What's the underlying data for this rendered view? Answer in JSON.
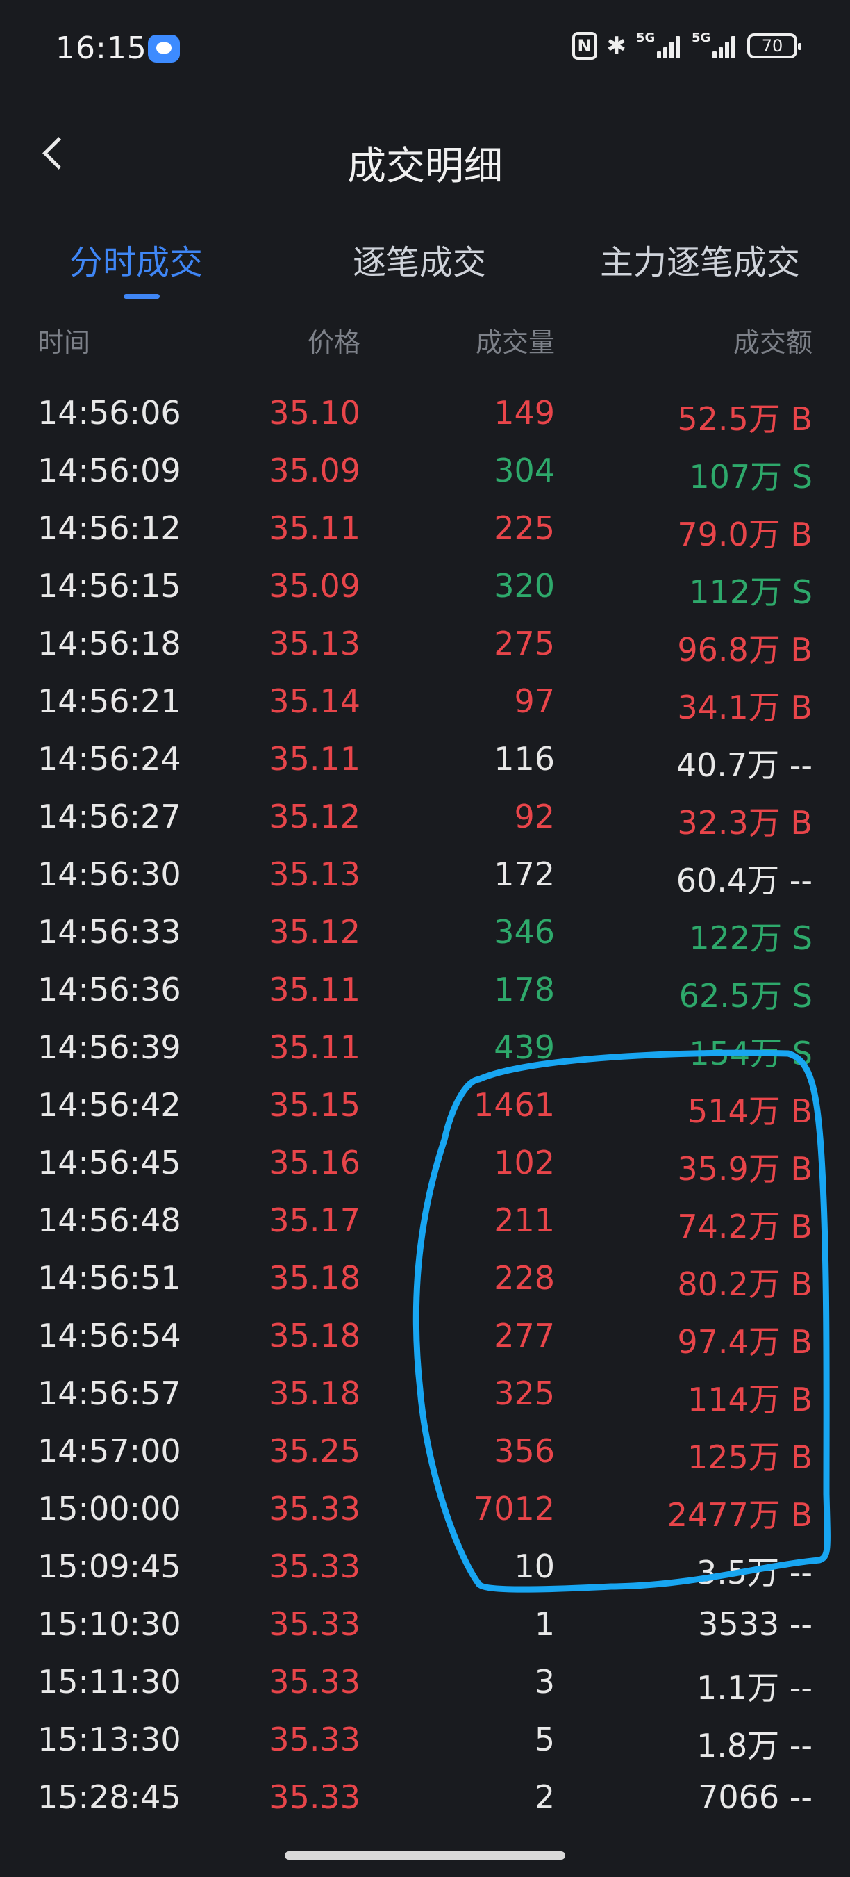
{
  "status_bar": {
    "time": "16:15",
    "signal1": "5G",
    "signal2": "5G",
    "battery": "70",
    "icons": [
      "message-app-icon",
      "nfc-icon",
      "bluetooth-icon",
      "signal-5g-icon",
      "signal-5g-icon",
      "battery-icon"
    ]
  },
  "header": {
    "title": "成交明细",
    "back_icon": "chevron-left-icon"
  },
  "tabs": [
    {
      "label": "分时成交",
      "active": true
    },
    {
      "label": "逐笔成交",
      "active": false
    },
    {
      "label": "主力逐笔成交",
      "active": false
    }
  ],
  "columns": {
    "time": "时间",
    "price": "价格",
    "volume": "成交量",
    "amount": "成交额"
  },
  "colors": {
    "up": "#e8454a",
    "down": "#2ea96b",
    "neutral": "#e8e8e8",
    "accent": "#3f86f5",
    "annotation": "#18a6f2"
  },
  "trades": [
    {
      "time": "14:56:06",
      "price": "35.10",
      "volume": "149",
      "amount": "52.5万 B",
      "side": "B"
    },
    {
      "time": "14:56:09",
      "price": "35.09",
      "volume": "304",
      "amount": "107万 S",
      "side": "S"
    },
    {
      "time": "14:56:12",
      "price": "35.11",
      "volume": "225",
      "amount": "79.0万 B",
      "side": "B"
    },
    {
      "time": "14:56:15",
      "price": "35.09",
      "volume": "320",
      "amount": "112万 S",
      "side": "S"
    },
    {
      "time": "14:56:18",
      "price": "35.13",
      "volume": "275",
      "amount": "96.8万 B",
      "side": "B"
    },
    {
      "time": "14:56:21",
      "price": "35.14",
      "volume": "97",
      "amount": "34.1万 B",
      "side": "B"
    },
    {
      "time": "14:56:24",
      "price": "35.11",
      "volume": "116",
      "amount": "40.7万 --",
      "side": "-"
    },
    {
      "time": "14:56:27",
      "price": "35.12",
      "volume": "92",
      "amount": "32.3万 B",
      "side": "B"
    },
    {
      "time": "14:56:30",
      "price": "35.13",
      "volume": "172",
      "amount": "60.4万 --",
      "side": "-"
    },
    {
      "time": "14:56:33",
      "price": "35.12",
      "volume": "346",
      "amount": "122万 S",
      "side": "S"
    },
    {
      "time": "14:56:36",
      "price": "35.11",
      "volume": "178",
      "amount": "62.5万 S",
      "side": "S"
    },
    {
      "time": "14:56:39",
      "price": "35.11",
      "volume": "439",
      "amount": "154万 S",
      "side": "S"
    },
    {
      "time": "14:56:42",
      "price": "35.15",
      "volume": "1461",
      "amount": "514万 B",
      "side": "B"
    },
    {
      "time": "14:56:45",
      "price": "35.16",
      "volume": "102",
      "amount": "35.9万 B",
      "side": "B"
    },
    {
      "time": "14:56:48",
      "price": "35.17",
      "volume": "211",
      "amount": "74.2万 B",
      "side": "B"
    },
    {
      "time": "14:56:51",
      "price": "35.18",
      "volume": "228",
      "amount": "80.2万 B",
      "side": "B"
    },
    {
      "time": "14:56:54",
      "price": "35.18",
      "volume": "277",
      "amount": "97.4万 B",
      "side": "B"
    },
    {
      "time": "14:56:57",
      "price": "35.18",
      "volume": "325",
      "amount": "114万 B",
      "side": "B"
    },
    {
      "time": "14:57:00",
      "price": "35.25",
      "volume": "356",
      "amount": "125万 B",
      "side": "B"
    },
    {
      "time": "15:00:00",
      "price": "35.33",
      "volume": "7012",
      "amount": "2477万 B",
      "side": "B"
    },
    {
      "time": "15:09:45",
      "price": "35.33",
      "volume": "10",
      "amount": "3.5万 --",
      "side": "-"
    },
    {
      "time": "15:10:30",
      "price": "35.33",
      "volume": "1",
      "amount": "3533 --",
      "side": "-"
    },
    {
      "time": "15:11:30",
      "price": "35.33",
      "volume": "3",
      "amount": "1.1万 --",
      "side": "-"
    },
    {
      "time": "15:13:30",
      "price": "35.33",
      "volume": "5",
      "amount": "1.8万 --",
      "side": "-"
    },
    {
      "time": "15:28:45",
      "price": "35.33",
      "volume": "2",
      "amount": "7066 --",
      "side": "-"
    }
  ]
}
